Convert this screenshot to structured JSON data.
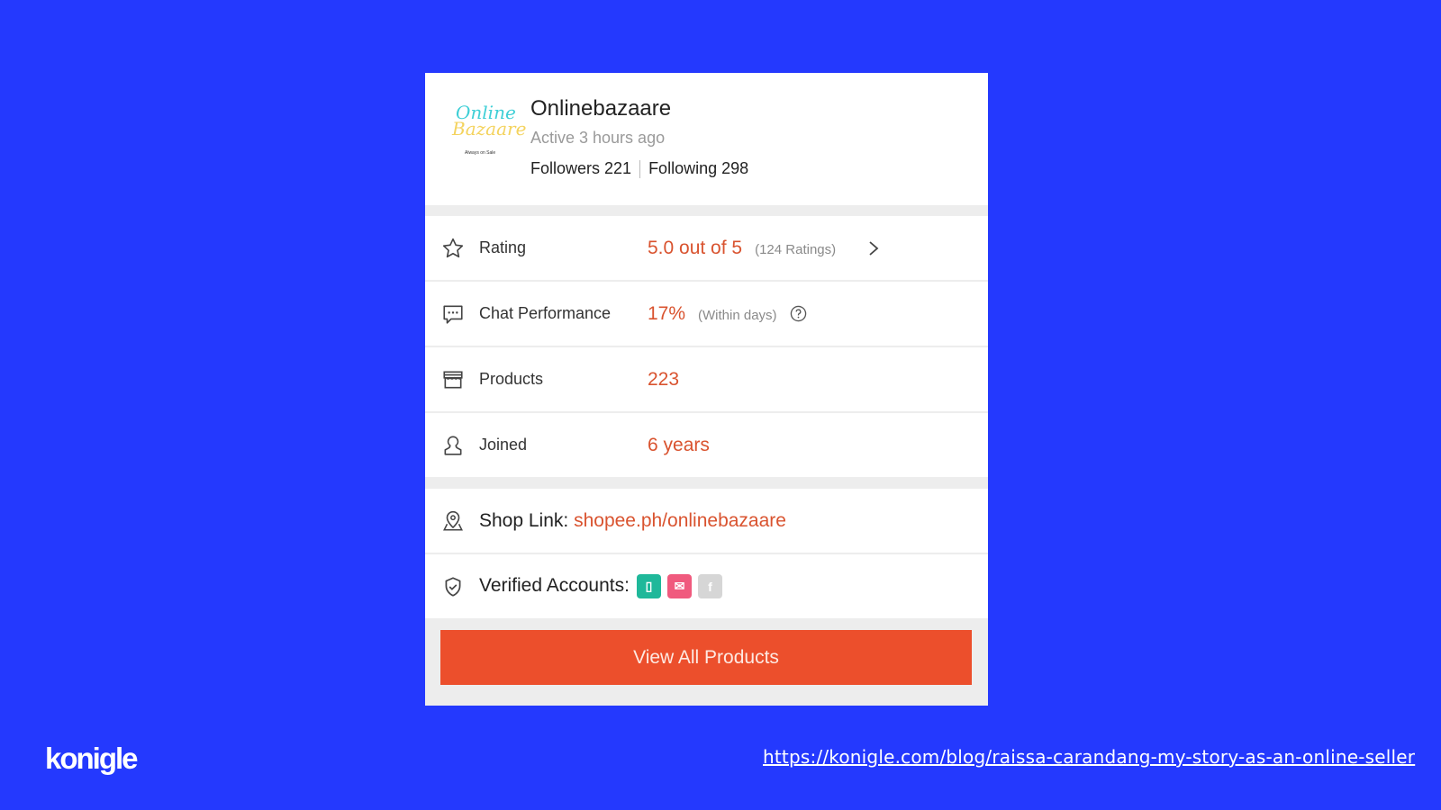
{
  "shop": {
    "name": "Onlinebazaare",
    "status": "Active 3 hours ago",
    "followers": "Followers 221",
    "following": "Following 298",
    "logo_line1": "Online",
    "logo_line2": "Bazaare",
    "logo_tagline": "Always on Sale"
  },
  "stats": [
    {
      "icon": "star-icon",
      "label": "Rating",
      "value": "5.0 out of 5",
      "sub": "(124 Ratings)"
    },
    {
      "icon": "chat-icon",
      "label": "Chat Performance",
      "value": "17%",
      "sub": "(Within days)"
    },
    {
      "icon": "store-icon",
      "label": "Products",
      "value": "223",
      "sub": ""
    },
    {
      "icon": "user-icon",
      "label": "Joined",
      "value": "6 years",
      "sub": ""
    }
  ],
  "shop_link": {
    "label": "Shop Link:",
    "url": "shopee.ph/onlinebazaare"
  },
  "verified": {
    "label": "Verified Accounts:",
    "accounts": [
      {
        "name": "phone",
        "glyph": "▯",
        "color": "#1fb89a"
      },
      {
        "name": "email",
        "glyph": "✉",
        "color": "#f05a7e"
      },
      {
        "name": "facebook",
        "glyph": "f",
        "color": "#d6d6d6"
      }
    ]
  },
  "button": {
    "label": "View All Products"
  },
  "footer": {
    "brand": "konigle",
    "url": "https://konigle.com/blog/raissa-carandang-my-story-as-an-online-seller"
  },
  "colors": {
    "background": "#2439fe",
    "accent": "#d9532f",
    "button": "#ec4f2c"
  }
}
